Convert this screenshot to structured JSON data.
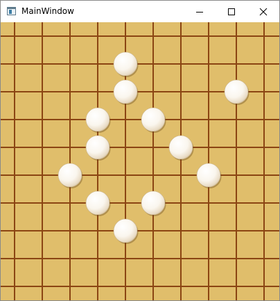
{
  "window": {
    "title": "MainWindow",
    "icon": "app-window-icon",
    "controls": {
      "minimize": "minimize-icon",
      "maximize": "maximize-icon",
      "close": "close-icon"
    }
  },
  "board": {
    "background": "#e0be6b",
    "line_color": "#8b4513",
    "columns": 10,
    "rows": 10,
    "stone_color": "white",
    "stones": [
      {
        "col": 4,
        "row": 1
      },
      {
        "col": 4,
        "row": 2
      },
      {
        "col": 8,
        "row": 2
      },
      {
        "col": 3,
        "row": 3
      },
      {
        "col": 5,
        "row": 3
      },
      {
        "col": 3,
        "row": 4
      },
      {
        "col": 6,
        "row": 4
      },
      {
        "col": 2,
        "row": 5
      },
      {
        "col": 7,
        "row": 5
      },
      {
        "col": 3,
        "row": 6
      },
      {
        "col": 5,
        "row": 6
      },
      {
        "col": 4,
        "row": 7
      }
    ]
  }
}
